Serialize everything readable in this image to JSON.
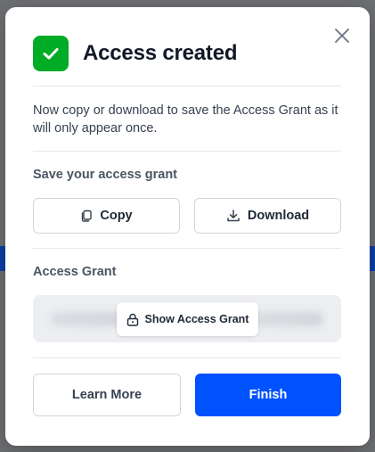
{
  "modal": {
    "title": "Access created",
    "description": "Now copy or download to save the Access Grant as it will only appear once.",
    "save_section_label": "Save your access grant",
    "copy_label": "Copy",
    "download_label": "Download",
    "grant_section_label": "Access Grant",
    "show_grant_label": "Show Access Grant",
    "learn_more_label": "Learn More",
    "finish_label": "Finish"
  },
  "icons": {
    "success": "check-icon",
    "close": "close-icon",
    "copy": "copy-icon",
    "download": "download-icon",
    "lock": "lock-icon"
  },
  "colors": {
    "success": "#00ac26",
    "primary": "#0052ff",
    "overlay": "#6e6f73"
  }
}
